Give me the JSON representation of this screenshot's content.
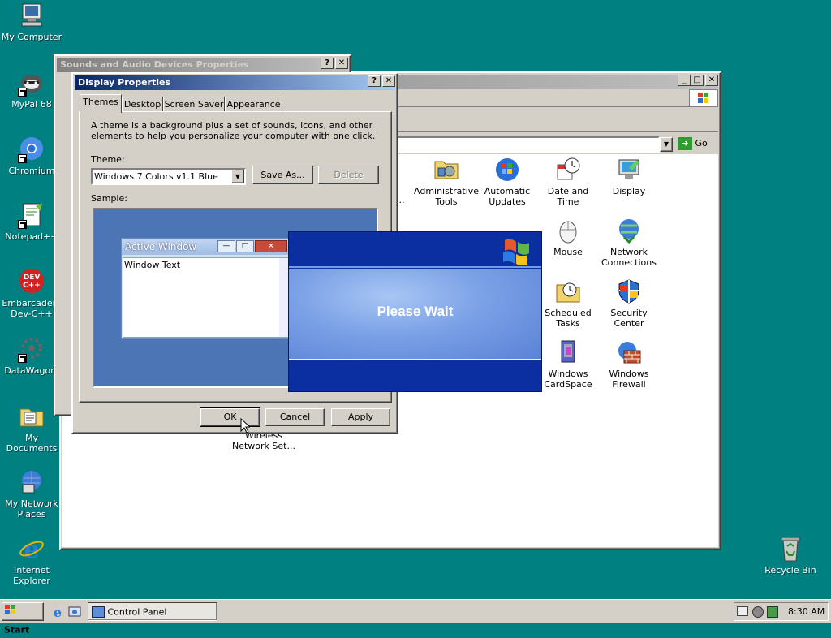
{
  "desktop": {
    "icons": [
      {
        "label": "My Computer"
      },
      {
        "label": "MyPal 68"
      },
      {
        "label": "Chromium"
      },
      {
        "label": "Notepad++"
      },
      {
        "label": "Embarcadero Dev-C++"
      },
      {
        "label": "DataWagon."
      },
      {
        "label": "My Documents"
      },
      {
        "label": "My Network Places"
      },
      {
        "label": "Internet Explorer"
      }
    ],
    "recycle_bin": "Recycle Bin"
  },
  "sounds_window": {
    "title": "Sounds and Audio Devices Properties",
    "help": "?",
    "close": "✕"
  },
  "control_panel": {
    "go_label": "Go",
    "items": [
      {
        "label": "Administrative Tools"
      },
      {
        "label": "Automatic Updates"
      },
      {
        "label": "Date and Time"
      },
      {
        "label": "Display"
      },
      {
        "label": "Mouse"
      },
      {
        "label": "Network Connections"
      },
      {
        "label": "Scheduled Tasks"
      },
      {
        "label": "Security Center"
      },
      {
        "label": "Windows CardSpace"
      },
      {
        "label": "Windows Firewall"
      },
      {
        "label": "Wireless Network Set..."
      }
    ],
    "truncated_label": "..."
  },
  "display_properties": {
    "title": "Display Properties",
    "help": "?",
    "close": "✕",
    "tabs": [
      "Themes",
      "Desktop",
      "Screen Saver",
      "Appearance"
    ],
    "description": "A theme is a background plus a set of sounds, icons, and other elements to help you personalize your computer with one click.",
    "theme_label": "Theme:",
    "theme_value": "Windows 7 Colors v1.1 Blue",
    "save_as": "Save As...",
    "delete": "Delete",
    "sample_label": "Sample:",
    "sample_window_title": "Active Window",
    "sample_window_text": "Window Text",
    "ok": "OK",
    "cancel": "Cancel",
    "apply": "Apply"
  },
  "please_wait": {
    "message": "Please Wait"
  },
  "taskbar": {
    "start": "Start",
    "task": "Control Panel",
    "clock": "8:30 AM"
  },
  "colors": {
    "desktop": "#008080",
    "title_active": "#0a246a",
    "xp_blue": "#0f2fa0"
  }
}
